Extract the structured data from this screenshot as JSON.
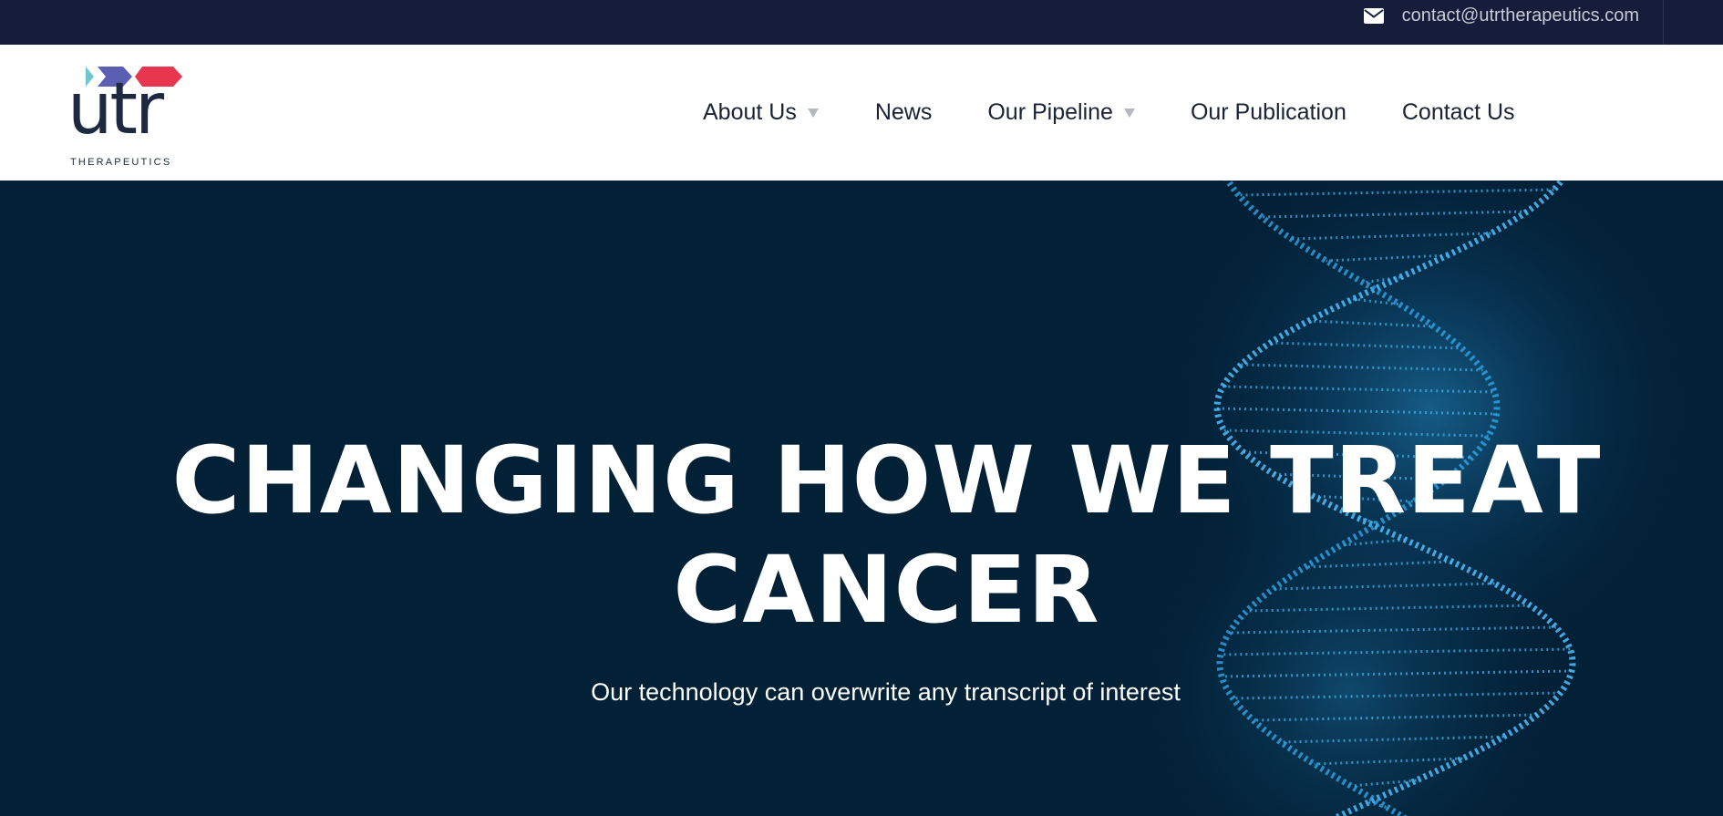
{
  "topbar": {
    "email": "contact@utrtherapeutics.com"
  },
  "logo": {
    "wordmark": "utr",
    "subtitle": "THERAPEUTICS"
  },
  "nav": {
    "items": [
      {
        "label": "About Us",
        "has_dropdown": true
      },
      {
        "label": "News",
        "has_dropdown": false
      },
      {
        "label": "Our Pipeline",
        "has_dropdown": true
      },
      {
        "label": "Our Publication",
        "has_dropdown": false
      },
      {
        "label": "Contact Us",
        "has_dropdown": false
      }
    ]
  },
  "hero": {
    "headline_line1": "CHANGING HOW WE TREAT",
    "headline_line2": "CANCER",
    "tagline": "Our technology can overwrite any transcript of interest"
  },
  "colors": {
    "topbar_bg": "#151d3b",
    "hero_bg": "#022036",
    "logo_navy": "#1d2940",
    "chevron_teal": "#6ec6d0",
    "chevron_purple": "#5b5fb3",
    "chevron_red": "#e8364f",
    "dna_blue": "#2ea6e8"
  },
  "icons": [
    "envelope-icon",
    "chevron-down-icon",
    "dna-helix-graphic"
  ]
}
